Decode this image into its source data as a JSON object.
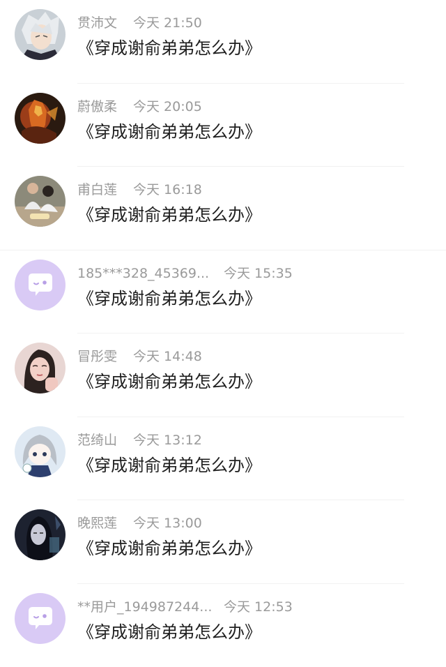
{
  "comments": [
    {
      "user": "贯沛文",
      "time": "今天 21:50",
      "text": "《穿成谢俞弟弟怎么办》",
      "avatar_icon": "anime-white-hair-avatar"
    },
    {
      "user": "蔚傲柔",
      "time": "今天 20:05",
      "text": "《穿成谢俞弟弟怎么办》",
      "avatar_icon": "fire-hero-avatar"
    },
    {
      "user": "甫白莲",
      "time": "今天 16:18",
      "text": "《穿成谢俞弟弟怎么办》",
      "avatar_icon": "family-photo-avatar"
    },
    {
      "user": "185***328_45369...",
      "time": "今天 15:35",
      "text": "《穿成谢俞弟弟怎么办》",
      "avatar_icon": "default-chat-bubble-avatar"
    },
    {
      "user": "冒彤雯",
      "time": "今天 14:48",
      "text": "《穿成谢俞弟弟怎么办》",
      "avatar_icon": "woman-selfie-avatar"
    },
    {
      "user": "范绮山",
      "time": "今天 13:12",
      "text": "《穿成谢俞弟弟怎么办》",
      "avatar_icon": "anime-girl-avatar"
    },
    {
      "user": "晚熙莲",
      "time": "今天 13:00",
      "text": "《穿成谢俞弟弟怎么办》",
      "avatar_icon": "dark-fantasy-avatar"
    },
    {
      "user": "**用户_194987244...",
      "time": "今天 12:53",
      "text": "《穿成谢俞弟弟怎么办》",
      "avatar_icon": "default-chat-bubble-avatar"
    }
  ],
  "colors": {
    "name": "#9a9a9a",
    "text": "#1f1f1f",
    "default_avatar_bg": "#d9caf5"
  }
}
